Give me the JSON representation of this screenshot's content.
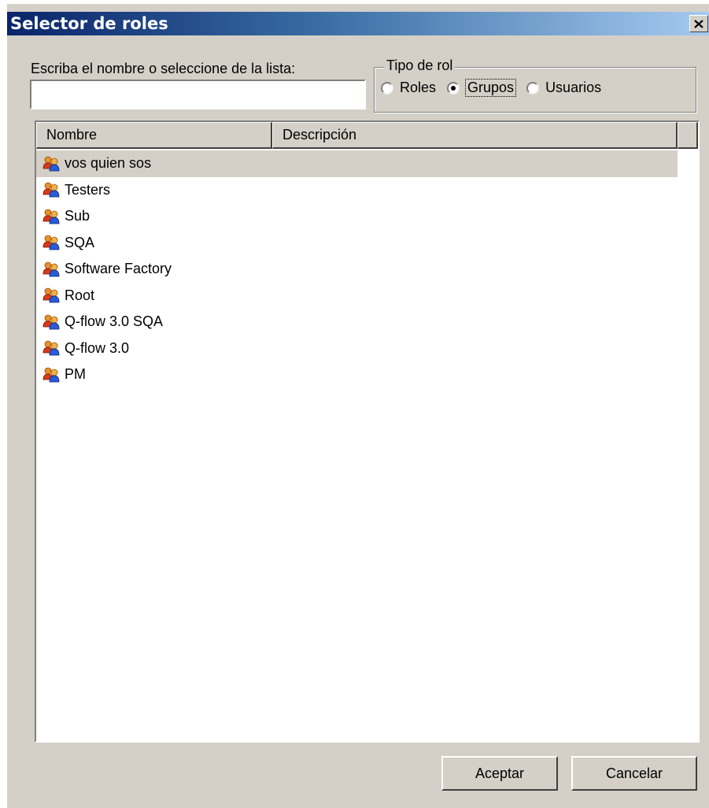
{
  "window": {
    "title": "Selector de roles",
    "close_label": "×"
  },
  "search": {
    "label": "Escriba el nombre o seleccione de la lista:",
    "value": ""
  },
  "role_type": {
    "legend": "Tipo de rol",
    "options": [
      {
        "label": "Roles",
        "checked": false
      },
      {
        "label": "Grupos",
        "checked": true
      },
      {
        "label": "Usuarios",
        "checked": false
      }
    ]
  },
  "list": {
    "columns": [
      "Nombre",
      "Descripción"
    ],
    "rows": [
      {
        "name": "vos quien sos",
        "description": "",
        "selected": true
      },
      {
        "name": "Testers",
        "description": ""
      },
      {
        "name": "Sub",
        "description": ""
      },
      {
        "name": "SQA",
        "description": ""
      },
      {
        "name": "Software Factory",
        "description": ""
      },
      {
        "name": "Root",
        "description": ""
      },
      {
        "name": "Q-flow 3.0 SQA",
        "description": ""
      },
      {
        "name": "Q-flow 3.0",
        "description": ""
      },
      {
        "name": "PM",
        "description": ""
      }
    ],
    "row_icon": "group-icon"
  },
  "buttons": {
    "accept": "Aceptar",
    "cancel": "Cancelar"
  },
  "colors": {
    "titlebar_start": "#0a246a",
    "titlebar_end": "#a6caf0",
    "dialog_face": "#d4d0c8"
  }
}
